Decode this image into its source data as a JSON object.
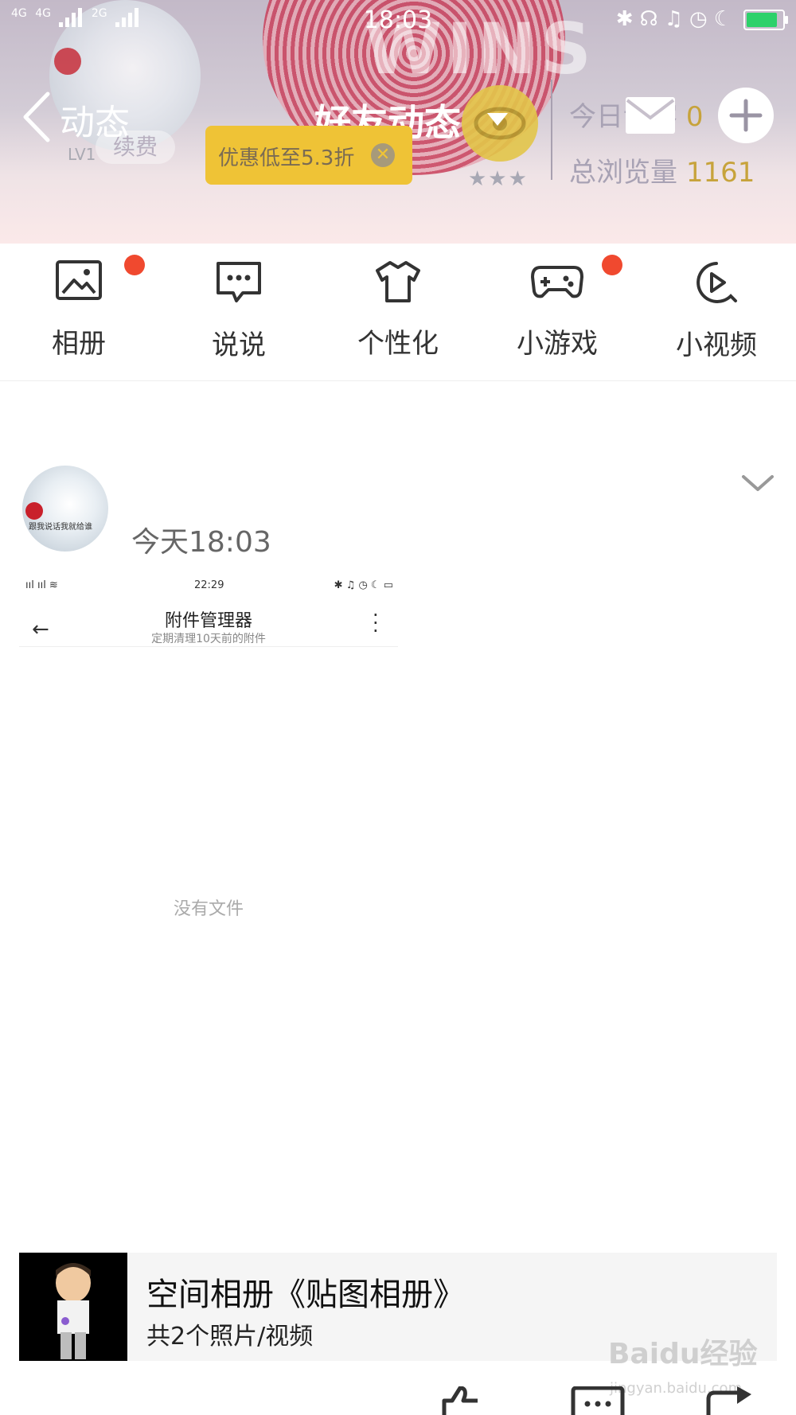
{
  "status_bar": {
    "signal1": "4G",
    "signal2": "4G",
    "signal3": "2G",
    "time": "18:03",
    "icons": [
      "bluetooth-icon",
      "headset-icon",
      "bell-off-icon",
      "alarm-icon",
      "moon-icon",
      "battery-charging-icon"
    ]
  },
  "header": {
    "back_label": "动态",
    "title": "好友动态",
    "cover_text": "WINS",
    "level": "LV1",
    "renew_label": "续费",
    "promo_text": "优惠低至5.3折",
    "visits_today_label": "今日访客",
    "visits_today_value": "0",
    "visits_total_label": "总浏览量",
    "visits_total_value": "1161",
    "stars": "★★★"
  },
  "nav": [
    {
      "label": "相册",
      "badge": true
    },
    {
      "label": "说说",
      "badge": false
    },
    {
      "label": "个性化",
      "badge": false
    },
    {
      "label": "小游戏",
      "badge": true
    },
    {
      "label": "小视频",
      "badge": false
    }
  ],
  "post": {
    "time": "今天18:03",
    "avatar_caption": "跟我说话我就给谁",
    "screenshot": {
      "time": "22:29",
      "title": "附件管理器",
      "subtitle": "定期清理10天前的附件",
      "empty_text": "没有文件"
    },
    "album": {
      "title": "空间相册《贴图相册》",
      "subtitle": "共2个照片/视频"
    }
  },
  "watermark": {
    "brand": "Baidu经验",
    "url": "jingyan.baidu.com"
  },
  "colors": {
    "badge": "#f0492f",
    "gold": "#c7a33b",
    "promo": "#efc336"
  }
}
